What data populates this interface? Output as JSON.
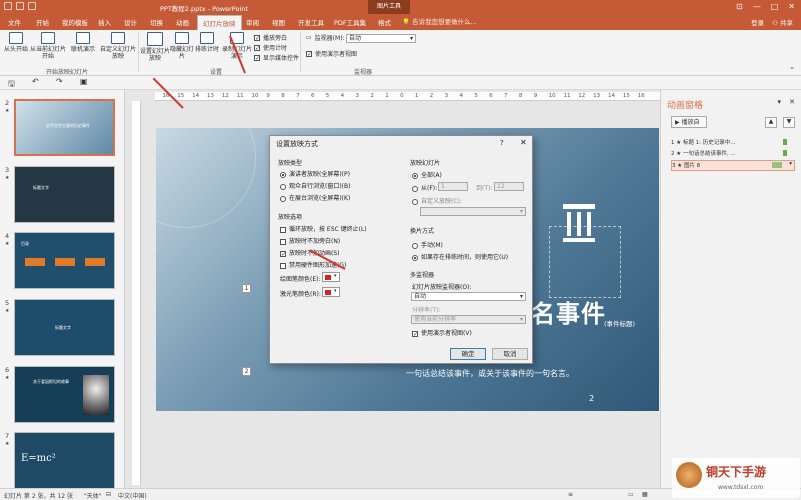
{
  "title_bar": {
    "doc_title": "PPT教程2.pptx - PowerPoint",
    "picture_tools": "图片工具"
  },
  "tabs": [
    "文件",
    "开始",
    "我的模板",
    "插入",
    "设计",
    "切换",
    "动画",
    "幻灯片放映",
    "审阅",
    "视图",
    "开发工具",
    "PDF工具集",
    "格式"
  ],
  "active_tab": "幻灯片放映",
  "search": {
    "placeholder": "告诉我您想要做什么..."
  },
  "user": {
    "login": "登录",
    "share": "共享"
  },
  "ribbon": {
    "buttons": [
      "从头开始",
      "从当前幻灯片开始",
      "联机演示",
      "自定义幻灯片放映",
      "设置幻灯片放映",
      "隐藏幻灯片",
      "排练计时",
      "录制幻灯片演示"
    ],
    "group_start": "开始放映幻灯片",
    "group_setup": "设置",
    "group_monitor": "监视器",
    "check_narration": "播放旁白",
    "check_timing": "使用计时",
    "check_media": "显示媒体控件",
    "monitor_label": "监视器(M):",
    "monitor_value": "自动",
    "presenter_view": "使用演示者视图"
  },
  "slides": [
    {
      "num": "2",
      "star": "★",
      "title": "近代北京主要的历史事件"
    },
    {
      "num": "3",
      "star": "★",
      "title": "标题文字"
    },
    {
      "num": "4",
      "star": "★",
      "title": "目录"
    },
    {
      "num": "5",
      "star": "★",
      "title": "标题文字"
    },
    {
      "num": "6",
      "star": "★",
      "title": "关于爱因斯坦的故事"
    },
    {
      "num": "7",
      "star": "★",
      "title": "E=mc²"
    }
  ],
  "ruler_ticks": [
    "16",
    "15",
    "14",
    "13",
    "12",
    "11",
    "10",
    "9",
    "8",
    "7",
    "6",
    "5",
    "4",
    "3",
    "2",
    "1",
    "0",
    "1",
    "2",
    "3",
    "4",
    "5",
    "6",
    "7",
    "8",
    "9",
    "10",
    "11",
    "12",
    "13",
    "14",
    "15",
    "16"
  ],
  "slide": {
    "headline": "名事件",
    "sub_tag": "(事件标题)",
    "caption": "一句话总结该事件，或关于该事件的一句名言。",
    "page_no": "2",
    "marker1": "1",
    "marker2": "2"
  },
  "anim_pane": {
    "title": "动画窗格",
    "play": "播放自",
    "items": [
      {
        "n": "1",
        "label": "标题 1: 历史记录中...",
        "color": "#6aa84f"
      },
      {
        "n": "2",
        "label": "一句话总结该事件, ...",
        "color": "#6aa84f"
      },
      {
        "n": "3",
        "label": "图片 8",
        "color": "#93c47d"
      }
    ]
  },
  "dialog": {
    "title": "设置放映方式",
    "help": "?",
    "show_type": "放映类型",
    "opt_speaker": "演讲者放映(全屏幕)(P)",
    "opt_browsed": "观众自行浏览(窗口)(B)",
    "opt_kiosk": "在展台浏览(全屏幕)(K)",
    "show_options": "放映选项",
    "loop": "循环放映，按 ESC 键终止(L)",
    "no_narration": "放映时不加旁白(N)",
    "no_animation": "放映时不加动画(S)",
    "disable_hw": "禁用硬件图形加速(G)",
    "pen_color": "绘图笔颜色(E):",
    "laser_color": "激光笔颜色(R):",
    "show_slides": "放映幻灯片",
    "all": "全部(A)",
    "from": "从(F):",
    "from_val": "1",
    "to": "到(T):",
    "to_val": "12",
    "custom": "自定义放映(C):",
    "advance": "换片方式",
    "manual": "手动(M)",
    "timings": "如果存在排练时间，则使用它(U)",
    "multi_monitor": "多监视器",
    "monitor_label": "幻灯片放映监视器(O):",
    "monitor_value": "自动",
    "resolution_label": "分辨率(T):",
    "resolution_value": "使用当前分辨率",
    "presenter_view": "使用演示者视图(V)",
    "ok": "确定",
    "cancel": "取消"
  },
  "status": {
    "slide": "幻灯片 第 2 张，共 12 张",
    "theme": "\"天体\"",
    "lang": "中文(中国)"
  },
  "watermark": {
    "text": "铜天下手游",
    "url": "www.tdsxl.com"
  }
}
